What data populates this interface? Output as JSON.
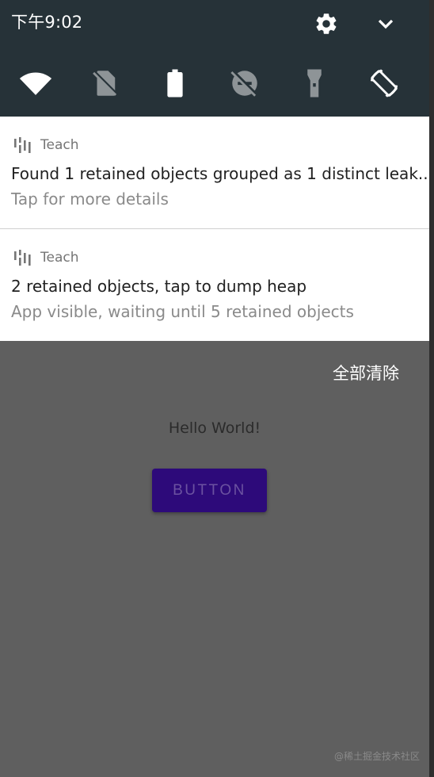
{
  "status_bar": {
    "time": "下午9:02"
  },
  "header_icons": [
    "gear-icon",
    "chevron-down-icon"
  ],
  "quick_settings": [
    "wifi-icon",
    "sim-off-icon",
    "battery-icon",
    "dnd-off-icon",
    "flashlight-icon",
    "auto-rotate-icon"
  ],
  "notifications": [
    {
      "app": "Teach",
      "title": "Found 1 retained objects grouped as 1 distinct leak..",
      "text": "Tap for more details"
    },
    {
      "app": "Teach",
      "title": "2 retained objects, tap to dump heap",
      "text": "App visible, waiting until 5 retained objects"
    }
  ],
  "clear_all": "全部清除",
  "app": {
    "hello_text": "Hello World!",
    "button_label": "BUTTON"
  },
  "watermark": "@稀土掘金技术社区"
}
